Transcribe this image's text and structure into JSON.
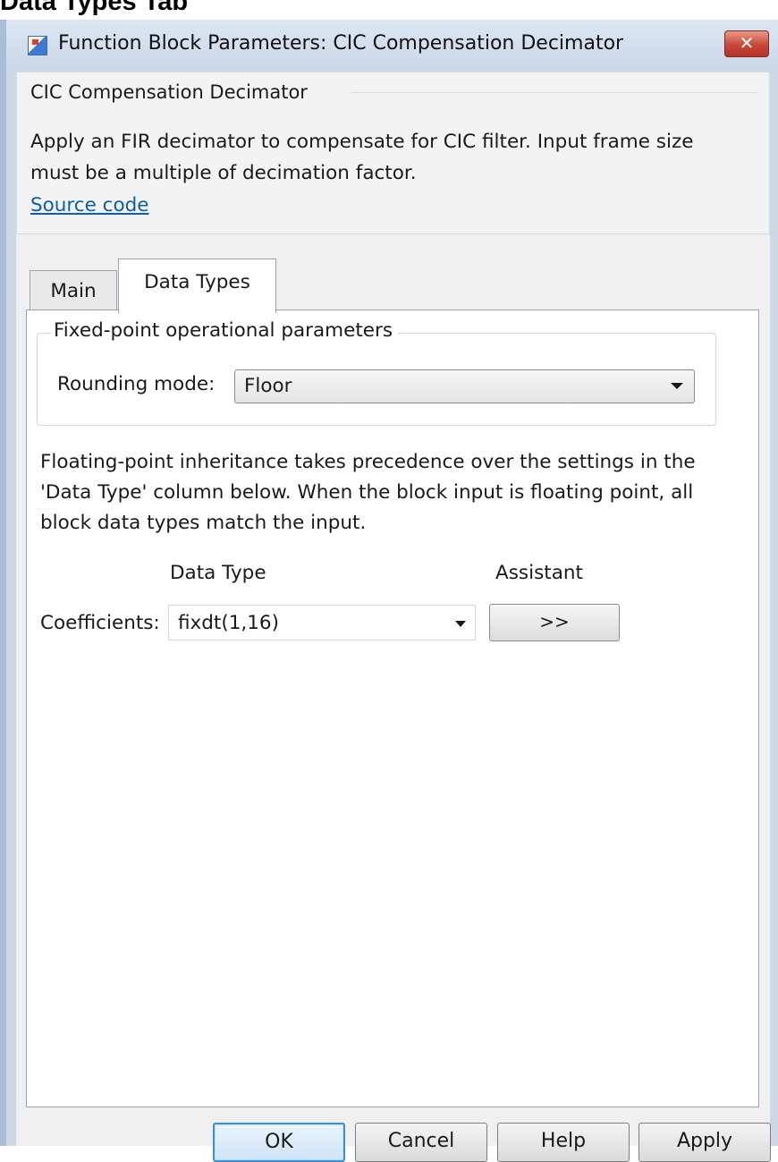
{
  "page": {
    "heading": "Data Types Tab"
  },
  "window": {
    "title": "Function Block Parameters: CIC Compensation Decimator",
    "close_label": "✕"
  },
  "description": {
    "group_title": "CIC Compensation Decimator",
    "text": "Apply an FIR decimator to compensate for CIC filter. Input frame size must be a multiple of decimation factor.",
    "link": "Source code"
  },
  "tabs": [
    {
      "label": "Main",
      "selected": false
    },
    {
      "label": "Data Types",
      "selected": true
    }
  ],
  "fixed_point": {
    "group_title": "Fixed-point operational parameters",
    "rounding_label": "Rounding mode:",
    "rounding_value": "Floor"
  },
  "inheritance_note": "Floating-point inheritance takes precedence over the settings in the 'Data Type' column below. When the block input is floating point, all block data types match the input.",
  "datatype_table": {
    "col_data_type": "Data Type",
    "col_assistant": "Assistant",
    "rows": [
      {
        "label": "Coefficients:",
        "value": "fixdt(1,16)",
        "assistant_button": ">>"
      }
    ]
  },
  "buttons": {
    "ok": "OK",
    "cancel": "Cancel",
    "help": "Help",
    "apply": "Apply"
  },
  "colors": {
    "link": "#0b5ea8",
    "close_button": "#c7473a",
    "default_button_border": "#3c8fd8",
    "window_frame": "#a9bdd6"
  }
}
